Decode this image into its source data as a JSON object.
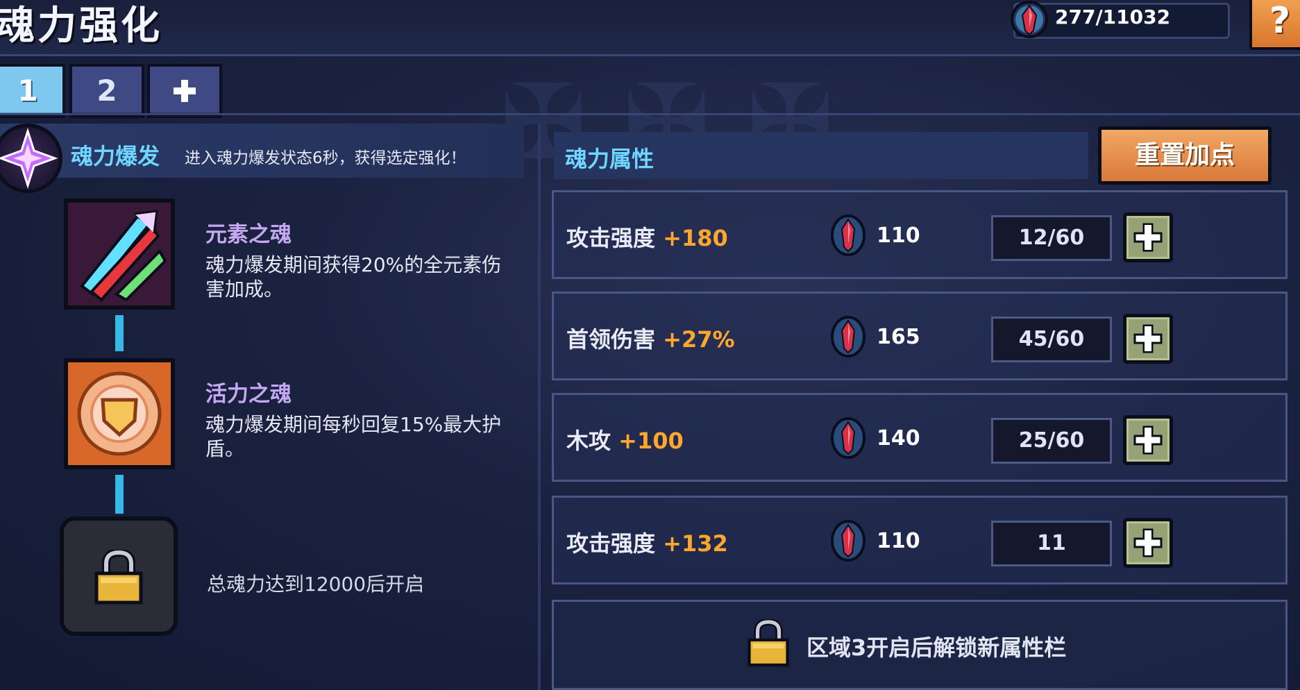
{
  "header": {
    "title": "魂力强化",
    "currency": {
      "icon": "soul-gem-icon",
      "text": "277/11032"
    },
    "help_label": "?"
  },
  "tabs": [
    {
      "label": "1",
      "active": true
    },
    {
      "label": "2",
      "active": false
    },
    {
      "label": "+",
      "icon": "plus-icon",
      "active": false
    }
  ],
  "burst": {
    "icon": "soul-burst-icon",
    "title": "魂力爆发",
    "description": "进入魂力爆发状态6秒，获得选定强化！"
  },
  "skills": [
    {
      "name": "元素之魂",
      "description": "魂力爆发期间获得20%的全元素伤害加成。",
      "icon": "elemental-blades-icon"
    },
    {
      "name": "活力之魂",
      "description": "魂力爆发期间每秒回复15%最大护盾。",
      "icon": "shield-emblem-icon"
    }
  ],
  "locked_skill": {
    "icon": "lock-icon",
    "text": "总魂力达到12000后开启"
  },
  "attributes": {
    "title": "魂力属性",
    "reset_label": "重置加点",
    "rows": [
      {
        "name": "攻击强度",
        "bonus": "+180",
        "cost": "110",
        "level": "12/60"
      },
      {
        "name": "首领伤害",
        "bonus": "+27%",
        "cost": "165",
        "level": "45/60"
      },
      {
        "name": "木攻",
        "bonus": "+100",
        "cost": "140",
        "level": "25/60"
      },
      {
        "name": "攻击强度",
        "bonus": "+132",
        "cost": "110",
        "level": "11"
      }
    ],
    "locked_row": {
      "icon": "lock-icon",
      "text": "区域3开启后解锁新属性栏"
    }
  },
  "colors": {
    "accent_cyan": "#6fd6ff",
    "bonus_orange": "#ffa72c",
    "reset_orange": "#e0813f",
    "plus_green": "#97a176",
    "skill_name_purple": "#c6a8f2"
  }
}
